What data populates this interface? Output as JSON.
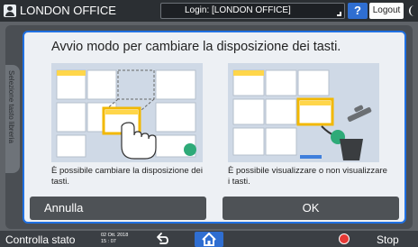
{
  "topbar": {
    "office_title": "LONDON OFFICE",
    "login_text": "Login: [LONDON OFFICE]",
    "help_label": "?",
    "logout_label": "Logout"
  },
  "side_tab": {
    "label": "Selezione tasto libreria"
  },
  "dialog": {
    "title": "Avvio modo per cambiare la disposizione dei tasti.",
    "caption_left": "È possibile cambiare la disposizione dei tasti.",
    "caption_right": "È possibile visualizzare o non visualizzare i tasti.",
    "cancel_label": "Annulla",
    "ok_label": "OK"
  },
  "bottombar": {
    "status_label": "Controlla stato",
    "date": "02 Ott. 2018",
    "time": "15 : 07",
    "stop_label": "Stop"
  },
  "colors": {
    "accent": "#1f6fe0",
    "highlight_yellow": "#ffd64a",
    "accent_green": "#2eaa78",
    "stop_red": "#e53935"
  }
}
